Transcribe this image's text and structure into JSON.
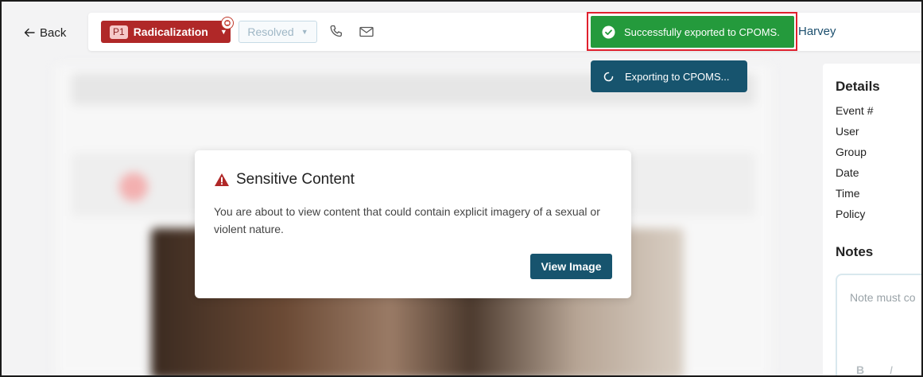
{
  "nav": {
    "back_label": "Back"
  },
  "toolbar": {
    "priority": "P1",
    "category": "Radicalization",
    "status": "Resolved",
    "user_name": "Harvey"
  },
  "toasts": {
    "success": "Successfully exported to CPOMS.",
    "progress": "Exporting to CPOMS..."
  },
  "modal": {
    "title": "Sensitive Content",
    "body": "You are about to view content that could contain explicit imagery of a sexual or violent nature.",
    "button": "View Image"
  },
  "details": {
    "heading": "Details",
    "fields": [
      "Event #",
      "User",
      "Group",
      "Date",
      "Time",
      "Policy"
    ],
    "notes_heading": "Notes",
    "note_placeholder": "Note must co",
    "format_bold": "B",
    "format_italic": "I"
  },
  "colors": {
    "category_bg": "#b02828",
    "success_bg": "#249a3c",
    "primary": "#17546e",
    "highlight": "#e0202e"
  }
}
